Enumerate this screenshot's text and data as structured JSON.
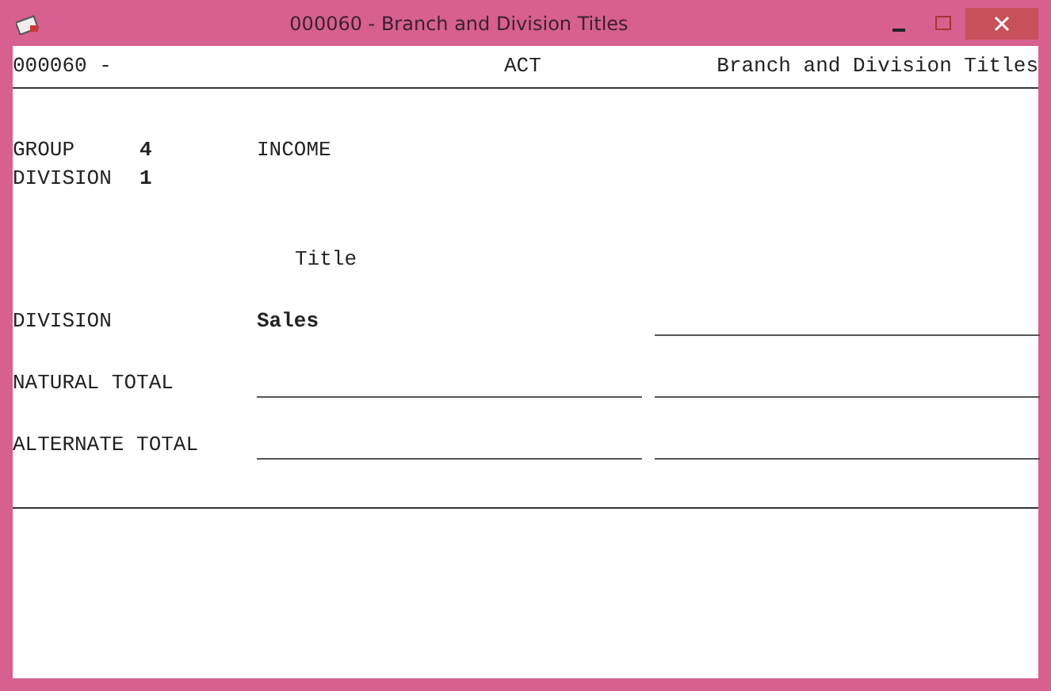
{
  "window": {
    "title": "000060 - Branch and Division Titles"
  },
  "header": {
    "left": "000060 -",
    "center": "ACT",
    "right": "Branch and Division Titles"
  },
  "info": [
    {
      "label": "GROUP",
      "value": "4",
      "description": "INCOME"
    },
    {
      "label": "DIVISION",
      "value": "1"
    }
  ],
  "column_heading": "Title",
  "fields": [
    {
      "label": "DIVISION",
      "values": [
        {
          "kind": "text",
          "value": "Sales"
        },
        {
          "kind": "blank"
        }
      ]
    },
    {
      "label": "NATURAL TOTAL",
      "values": [
        {
          "kind": "blank"
        },
        {
          "kind": "blank"
        }
      ]
    },
    {
      "label": "ALTERNATE TOTAL",
      "values": [
        {
          "kind": "blank"
        },
        {
          "kind": "blank"
        }
      ]
    }
  ]
}
